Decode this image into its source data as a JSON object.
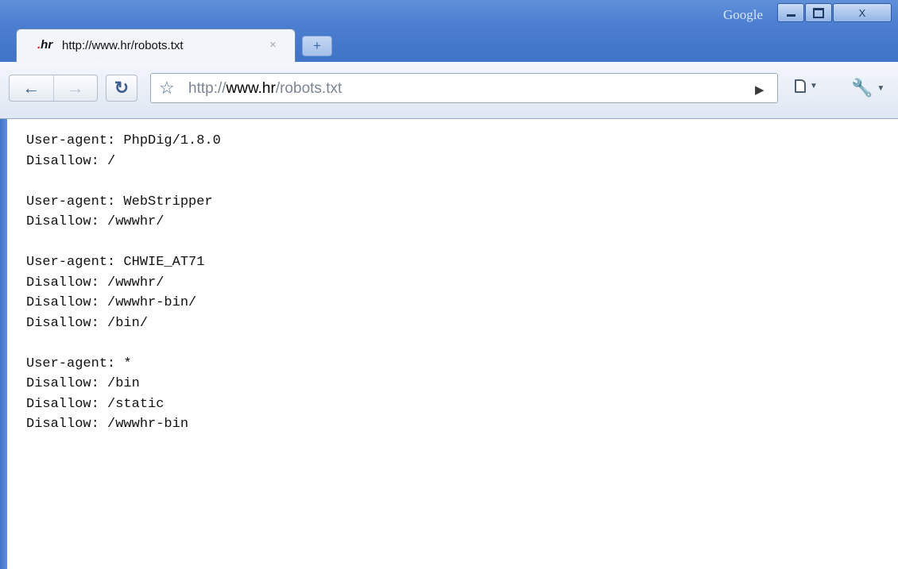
{
  "window": {
    "brand_label": "Google",
    "controls": {
      "minimize": "minimize",
      "maximize": "maximize",
      "close_glyph": "X"
    }
  },
  "tab": {
    "favicon_text": ".hr",
    "title": "http://www.hr/robots.txt",
    "close_glyph": "×",
    "new_tab_glyph": "+"
  },
  "toolbar": {
    "back_icon": "arrow-left-icon",
    "forward_icon": "arrow-right-icon",
    "reload_icon": "reload-icon",
    "star_icon": "star-icon",
    "url_prefix": "http://",
    "url_host": "www.hr",
    "url_path": "/robots.txt",
    "go_icon": "play-icon",
    "page_menu_icon": "page-icon",
    "tools_menu_icon": "wrench-icon"
  },
  "content": {
    "lines": [
      "User-agent: PhpDig/1.8.0",
      "Disallow: /",
      "",
      "User-agent: WebStripper",
      "Disallow: /wwwhr/",
      "",
      "User-agent: CHWIE_AT71",
      "Disallow: /wwwhr/",
      "Disallow: /wwwhr-bin/",
      "Disallow: /bin/",
      "",
      "User-agent: *",
      "Disallow: /bin",
      "Disallow: /static",
      "Disallow: /wwwhr-bin"
    ]
  },
  "colors": {
    "frame": "#4b7ed0",
    "favicon_dot": "#e02020"
  }
}
